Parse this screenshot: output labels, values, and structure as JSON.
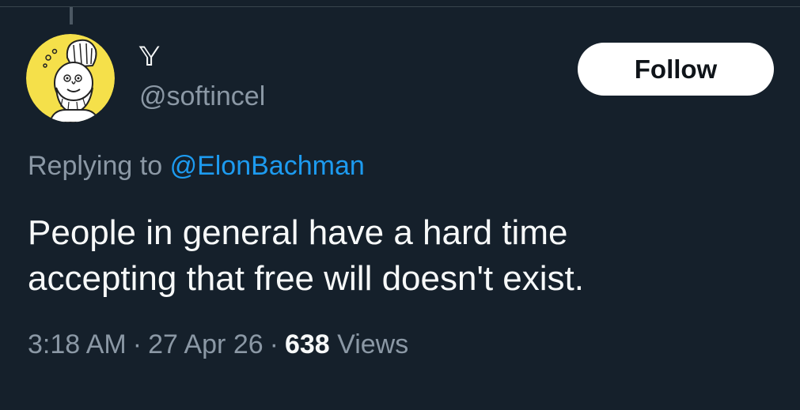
{
  "tweet": {
    "author": {
      "display_name": "𝕐",
      "handle": "@softincel",
      "avatar_icon": "cartoon-chef-avatar-icon"
    },
    "follow_label": "Follow",
    "replying_prefix": "Replying to",
    "replying_to": "@ElonBachman",
    "text_line1": "People in general have a hard time",
    "text_line2": "accepting that free will doesn't exist.",
    "time": "3:18 AM",
    "separator": "·",
    "date": "27 Apr 26",
    "views_count": "638",
    "views_label": "Views"
  },
  "colors": {
    "background": "#15202b",
    "text_primary": "#f7f9f9",
    "text_secondary": "#8b98a5",
    "link": "#1d9bf0",
    "follow_bg": "#ffffff",
    "avatar_bg": "#f5e04a"
  }
}
